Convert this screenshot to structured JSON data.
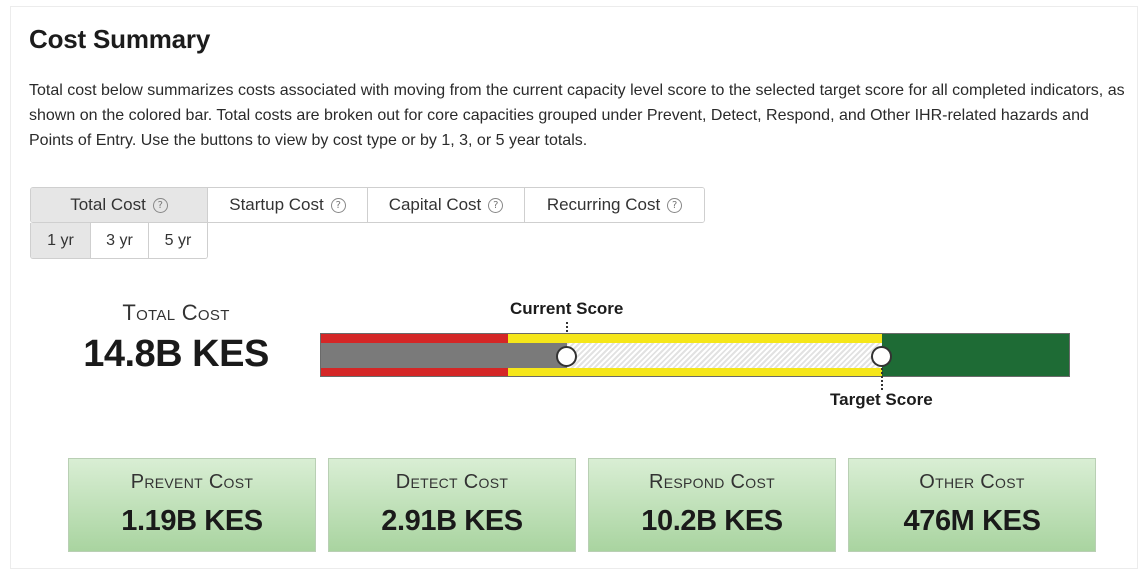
{
  "section": {
    "title": "Cost Summary",
    "description": "Total cost below summarizes costs associated with moving from the current capacity level score to the selected target score for all completed indicators, as shown on the colored bar. Total costs are broken out for core capacities grouped under Prevent, Detect, Respond, and Other IHR-related hazards and Points of Entry. Use the buttons to view by cost type or by 1, 3, or 5 year totals."
  },
  "cost_type_buttons": [
    {
      "label": "Total Cost",
      "active": true
    },
    {
      "label": "Startup Cost",
      "active": false
    },
    {
      "label": "Capital Cost",
      "active": false
    },
    {
      "label": "Recurring Cost",
      "active": false
    }
  ],
  "help_glyph": "?",
  "year_buttons": [
    {
      "label": "1 yr",
      "active": true
    },
    {
      "label": "3 yr",
      "active": false
    },
    {
      "label": "5 yr",
      "active": false
    }
  ],
  "total_cost": {
    "label": "Total Cost",
    "value": "14.8B KES"
  },
  "score_bar": {
    "current_label": "Current Score",
    "target_label": "Target Score",
    "current_score_fraction": 0.328,
    "target_score_fraction": 0.748,
    "level_colors": {
      "low": "#d42626",
      "mid": "#f5e61a",
      "high": "#1e6b35"
    }
  },
  "breakdown": [
    {
      "label": "Prevent Cost",
      "value": "1.19B KES"
    },
    {
      "label": "Detect Cost",
      "value": "2.91B KES"
    },
    {
      "label": "Respond Cost",
      "value": "10.2B KES"
    },
    {
      "label": "Other Cost",
      "value": "476M KES"
    }
  ],
  "icons": {
    "help": "question-circle-icon"
  }
}
